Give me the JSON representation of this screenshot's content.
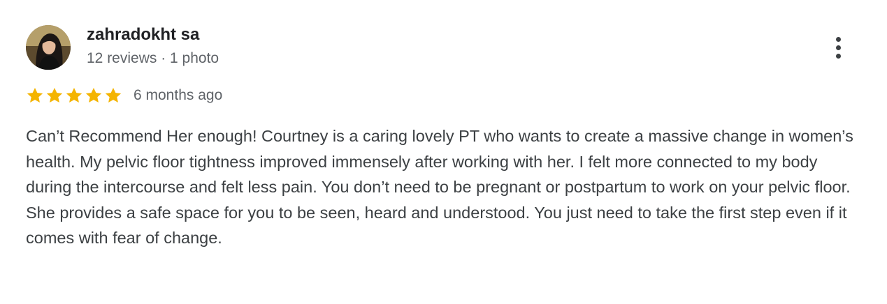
{
  "review": {
    "author": {
      "name": "zahradokht sa",
      "meta": "12 reviews · 1 photo",
      "avatar_icon": "profile-photo"
    },
    "rating": {
      "stars": 5,
      "max": 5,
      "color": "#f4b400"
    },
    "date": "6 months ago",
    "text": "Can’t Recommend Her enough! Courtney is a caring lovely PT who wants to create a massive change in women’s health. My pelvic floor tightness improved immensely after working with her. I felt more connected to my body during the intercourse and felt less pain. You don’t need to be pregnant or postpartum to work on your pelvic floor. She provides a safe space for you to be seen, heard and understood. You just need to take the first step even if it comes with fear of change.",
    "menu_icon": "more-vert-icon"
  }
}
